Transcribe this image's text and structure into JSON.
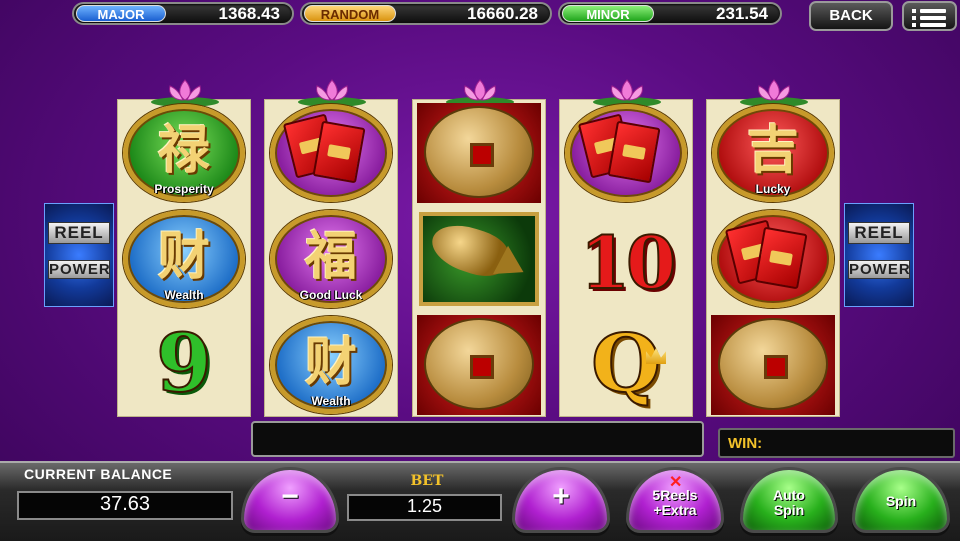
{
  "jackpots": [
    {
      "label": "MAJOR",
      "value": "1368.43"
    },
    {
      "label": "RANDOM",
      "value": "16660.28"
    },
    {
      "label": "MINOR",
      "value": "231.54"
    }
  ],
  "top_buttons": {
    "back": "BACK"
  },
  "side_logo": {
    "line1": "REEL",
    "line2": "POWER"
  },
  "reels": [
    {
      "symbols": [
        {
          "type": "prosperity",
          "glyph": "禄",
          "caption": "Prosperity"
        },
        {
          "type": "wealth",
          "glyph": "财",
          "caption": "Wealth"
        },
        {
          "type": "nine",
          "text": "9"
        }
      ]
    },
    {
      "symbols": [
        {
          "type": "red-envelopes"
        },
        {
          "type": "good-luck",
          "glyph": "福",
          "caption": "Good Luck"
        },
        {
          "type": "wealth",
          "glyph": "财",
          "caption": "Wealth"
        }
      ]
    },
    {
      "symbols": [
        {
          "type": "gold-coin"
        },
        {
          "type": "golden-koi"
        },
        {
          "type": "gold-coin"
        }
      ]
    },
    {
      "symbols": [
        {
          "type": "red-envelopes"
        },
        {
          "type": "ten",
          "text": "10"
        },
        {
          "type": "queen",
          "text": "Q"
        }
      ]
    },
    {
      "symbols": [
        {
          "type": "lucky",
          "glyph": "吉",
          "caption": "Lucky"
        },
        {
          "type": "red-envelopes"
        },
        {
          "type": "gold-coin"
        }
      ]
    }
  ],
  "message": "",
  "win": {
    "label": "WIN:",
    "value": ""
  },
  "balance": {
    "label": "CURRENT BALANCE",
    "value": "37.63"
  },
  "bet": {
    "label": "BET",
    "value": "1.25"
  },
  "controls": {
    "minus": "−",
    "plus": "+",
    "reels_line1": "5Reels",
    "reels_line2": "+Extra",
    "autospin_line1": "Auto",
    "autospin_line2": "Spin",
    "spin": "Spin"
  },
  "colors": {
    "background": "#5a0c82",
    "major": "#1a5fd0",
    "random": "#d9940f",
    "minor": "#1fa51b",
    "dome_purple": "#b020d0",
    "dome_green": "#28b01c",
    "win_text": "#f3c22a"
  }
}
